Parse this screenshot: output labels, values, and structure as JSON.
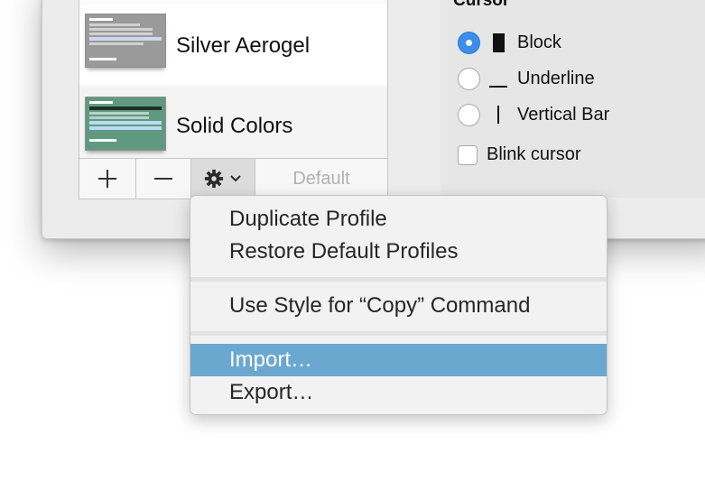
{
  "profiles": [
    {
      "name": "Silver Aerogel",
      "thumb_color": "#9a9a9a"
    },
    {
      "name": "Solid Colors",
      "thumb_color": "#5f9a80"
    }
  ],
  "toolbar": {
    "add_icon": "plus-icon",
    "remove_icon": "minus-icon",
    "gear_icon": "gear-icon",
    "chevron_icon": "chevron-down-icon",
    "default_label": "Default"
  },
  "cursor": {
    "title": "Cursor",
    "options": [
      {
        "label": "Block",
        "selected": true,
        "icon": "block-cursor-icon"
      },
      {
        "label": "Underline",
        "selected": false,
        "icon": "underline-cursor-icon"
      },
      {
        "label": "Vertical Bar",
        "selected": false,
        "icon": "vertical-bar-cursor-icon"
      }
    ],
    "blink_label": "Blink cursor",
    "blink_checked": false
  },
  "menu": {
    "items": [
      {
        "label": "Duplicate Profile"
      },
      {
        "label": "Restore Default Profiles"
      },
      {
        "label": "Use Style for “Copy” Command"
      },
      {
        "label": "Import…",
        "highlighted": true
      },
      {
        "label": "Export…"
      }
    ]
  },
  "colors": {
    "accent": "#3b8eea",
    "menu_highlight": "#6aa8cf"
  }
}
